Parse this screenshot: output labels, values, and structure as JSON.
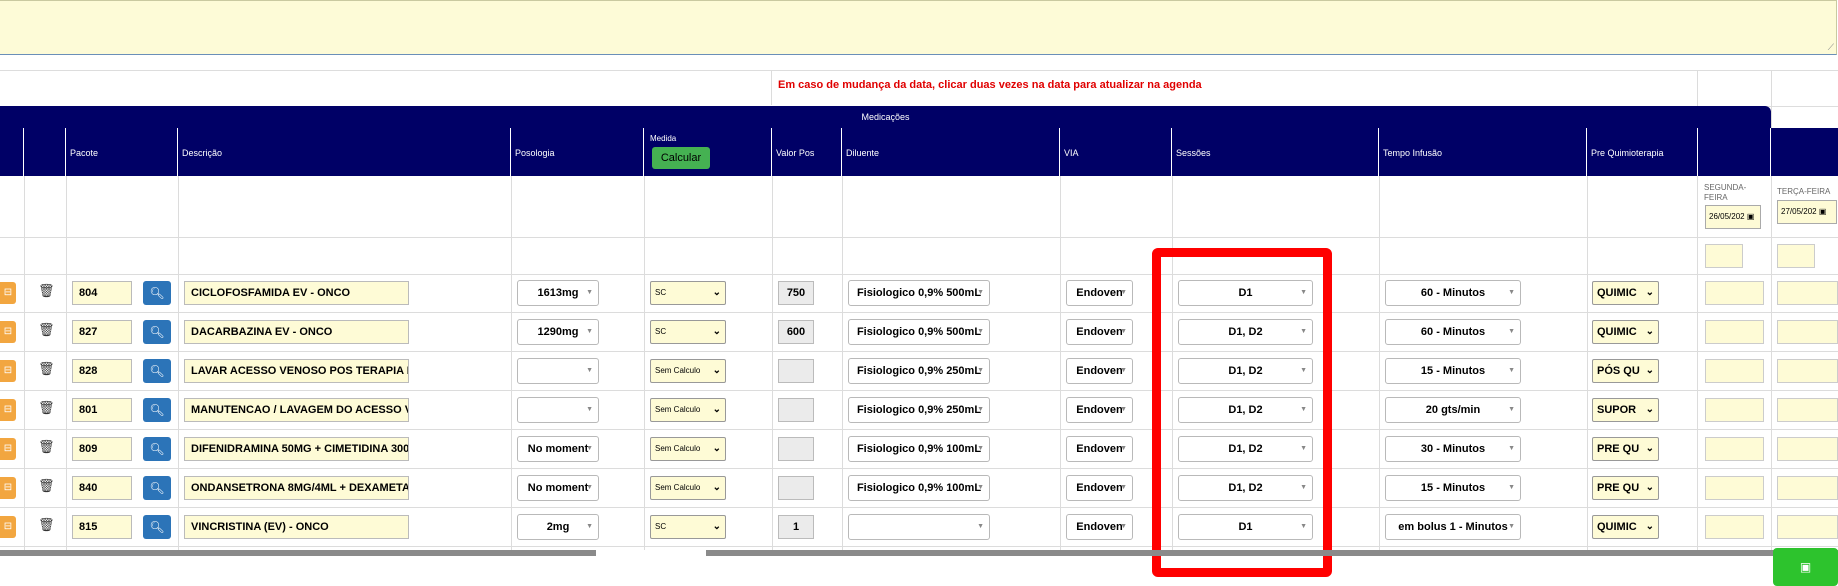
{
  "warning": "Em caso de mudança da data, clicar duas vezes na data para atualizar na agenda",
  "medicacoes_title": "Medicações",
  "headers": {
    "pacote": "Pacote",
    "descricao": "Descrição",
    "posologia": "Posologia",
    "medida": "Medida",
    "calcular": "Calcular",
    "valor_pos": "Valor Pos",
    "diluente": "Diluente",
    "via": "VIA",
    "sessoes": "Sessões",
    "tempo_infusao": "Tempo Infusão",
    "pre_quimio": "Pre Quimioterapia"
  },
  "days": [
    {
      "label1": "SEGUNDA-",
      "label2": "FEIRA",
      "date": "26/05/202"
    },
    {
      "label1": "TERÇA-FEIRA",
      "label2": "",
      "date": "27/05/202"
    }
  ],
  "rows": [
    {
      "code": "804",
      "desc": "CICLOFOSFAMIDA EV - ONCO",
      "poso": "1613mg",
      "medida": "SC",
      "valor": "750",
      "diluente": "Fisiologico 0,9% 500mL",
      "via": "Endoven",
      "sessoes": "D1",
      "tempo": "60 - Minutos",
      "pre": "QUIMIC"
    },
    {
      "code": "827",
      "desc": "DACARBAZINA EV - ONCO",
      "poso": "1290mg",
      "medida": "SC",
      "valor": "600",
      "diluente": "Fisiologico 0,9% 500mL",
      "via": "Endoven",
      "sessoes": "D1, D2",
      "tempo": "60 - Minutos",
      "pre": "QUIMIC"
    },
    {
      "code": "828",
      "desc": "LAVAR ACESSO VENOSO POS TERAPIA N",
      "poso": "",
      "medida": "Sem Calculo",
      "valor": "",
      "diluente": "Fisiologico 0,9% 250mL",
      "via": "Endoven",
      "sessoes": "D1, D2",
      "tempo": "15 - Minutos",
      "pre": "PÓS QU"
    },
    {
      "code": "801",
      "desc": "MANUTENCAO / LAVAGEM DO ACESSO V",
      "poso": "",
      "medida": "Sem Calculo",
      "valor": "",
      "diluente": "Fisiologico 0,9% 250mL",
      "via": "Endoven",
      "sessoes": "D1, D2",
      "tempo": "20 gts/min",
      "pre": "SUPOR"
    },
    {
      "code": "809",
      "desc": "DIFENIDRAMINA 50MG + CIMETIDINA 300I",
      "poso": "No moment",
      "medida": "Sem Calculo",
      "valor": "",
      "diluente": "Fisiologico 0,9% 100mL",
      "via": "Endoven",
      "sessoes": "D1, D2",
      "tempo": "30 - Minutos",
      "pre": "PRE QU"
    },
    {
      "code": "840",
      "desc": "ONDANSETRONA 8MG/4ML + DEXAMETA",
      "poso": "No moment",
      "medida": "Sem Calculo",
      "valor": "",
      "diluente": "Fisiologico 0,9% 100mL",
      "via": "Endoven",
      "sessoes": "D1, D2",
      "tempo": "15 - Minutos",
      "pre": "PRE QU"
    },
    {
      "code": "815",
      "desc": "VINCRISTINA (EV) - ONCO",
      "poso": "2mg",
      "medida": "SC",
      "valor": "1",
      "diluente": "",
      "via": "Endoven",
      "sessoes": "D1",
      "tempo": "em bolus 1 - Minutos",
      "pre": "QUIMIC"
    }
  ],
  "icons": {
    "search": "search-icon",
    "trash": "trash-icon",
    "save": "save-icon",
    "edit": "edit-icon"
  },
  "colors": {
    "header_bg": "#000066",
    "warning": "#e00000",
    "calc_button": "#45b152",
    "save_button": "#2dc32d",
    "highlight": "#ff0000"
  }
}
